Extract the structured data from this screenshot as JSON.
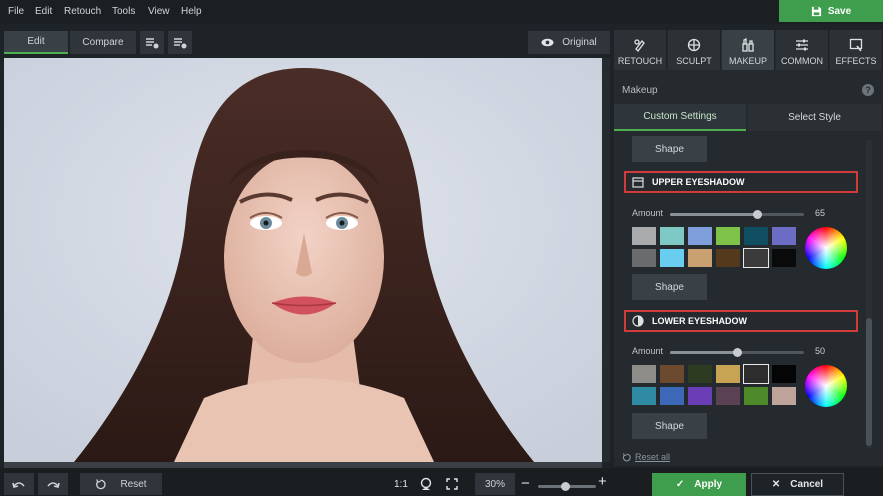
{
  "menu": {
    "file": "File",
    "edit": "Edit",
    "retouch": "Retouch",
    "tools": "Tools",
    "view": "View",
    "help": "Help"
  },
  "save_label": "Save",
  "toolbar": {
    "edit": "Edit",
    "compare": "Compare",
    "original": "Original"
  },
  "bottom": {
    "reset": "Reset",
    "ratio": "1:1",
    "zoom": "30%"
  },
  "zoom_fraction": 0.47,
  "tabs": [
    {
      "label": "RETOUCH",
      "icon": "retouch-icon"
    },
    {
      "label": "SCULPT",
      "icon": "sculpt-icon"
    },
    {
      "label": "MAKEUP",
      "icon": "makeup-icon"
    },
    {
      "label": "COMMON",
      "icon": "sliders-icon"
    },
    {
      "label": "EFFECTS",
      "icon": "effects-icon"
    }
  ],
  "panel": {
    "title": "Makeup",
    "subtabs": {
      "custom": "Custom Settings",
      "style": "Select Style"
    },
    "shape_label": "Shape",
    "upper": {
      "title": "UPPER EYESHADOW",
      "amount_label": "Amount",
      "amount": "65",
      "swatches": [
        "#a9aaab",
        "#7ec9c4",
        "#7f9fdc",
        "#7fc24a",
        "#0f4e63",
        "#6c6cc4",
        "#6a6b6d",
        "#69cdf0",
        "#c9a070",
        "#55391d",
        "#3b3b3b",
        "#0a0a0a"
      ]
    },
    "lower": {
      "title": "LOWER EYESHADOW",
      "amount_label": "Amount",
      "amount": "50",
      "swatches": [
        "#8d8c89",
        "#6b4a2f",
        "#2d3b20",
        "#c6a453",
        "#2d2d2d",
        "#050505",
        "#2f8aa3",
        "#3d67b7",
        "#6a3fb5",
        "#5a4254",
        "#4e8a2a",
        "#bfa39b"
      ]
    },
    "reset_all": "Reset all"
  },
  "actions": {
    "apply": "Apply",
    "cancel": "Cancel"
  }
}
